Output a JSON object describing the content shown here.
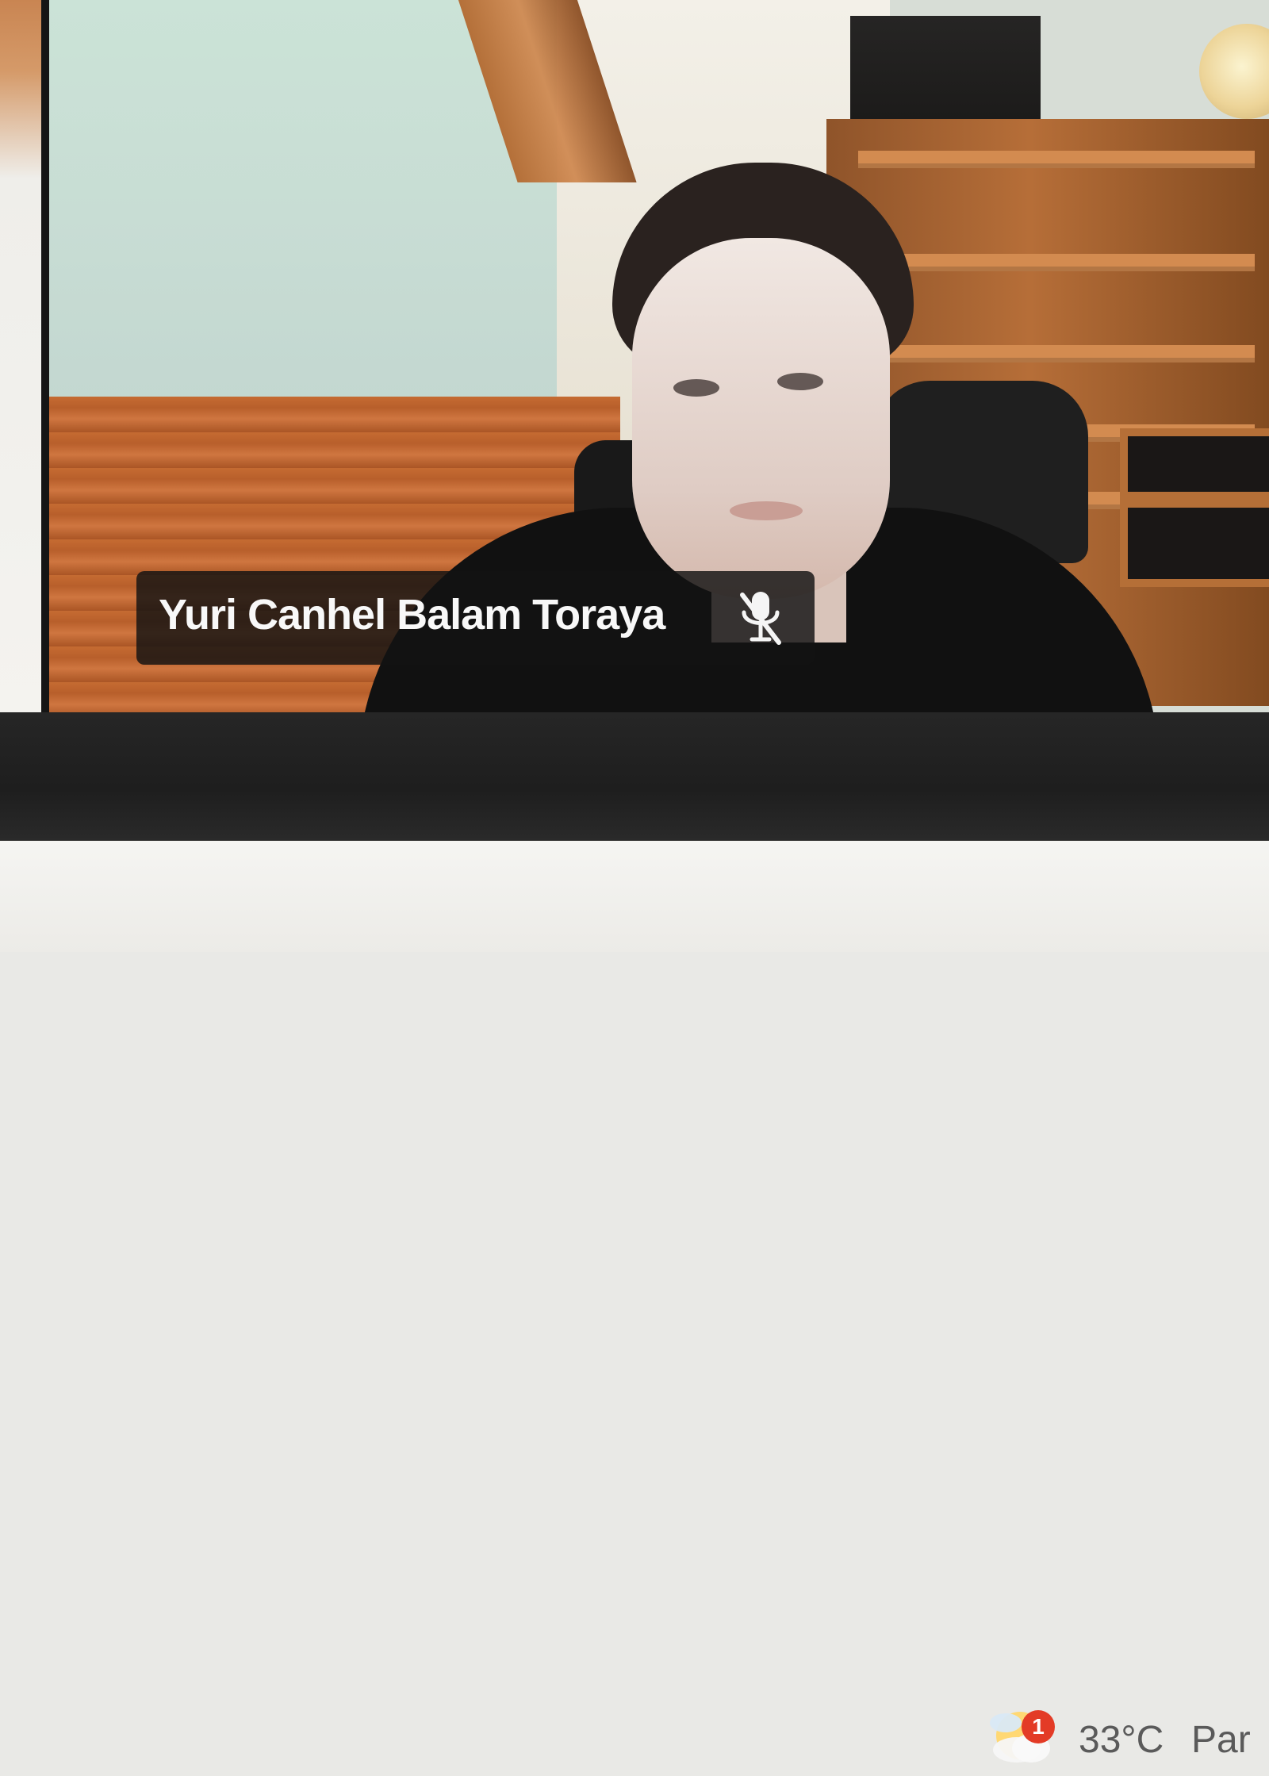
{
  "meeting": {
    "participant": {
      "name": "Yuri Canhel Balam Toraya",
      "mic_state_icon": "mic-muted-icon"
    }
  },
  "taskbar": {
    "weather": {
      "temperature": "33°C",
      "condition_partial": "Par",
      "notification_count": "1",
      "icon": "weather-cloud-icon"
    }
  },
  "colors": {
    "name_tag_bg": "#121212",
    "toolbar_bg": "#232323",
    "taskbar_bg": "#f2f1ed",
    "badge_red": "#e33b26"
  }
}
